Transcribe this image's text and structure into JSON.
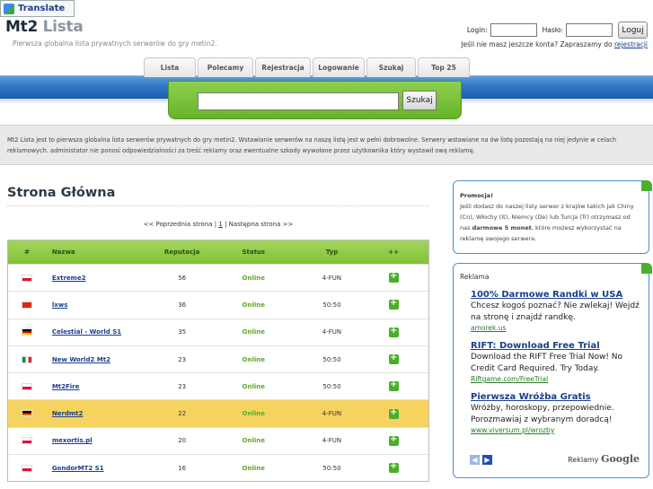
{
  "translate": {
    "label": "Translate"
  },
  "brand": {
    "name_a": "Mt2",
    "name_b": "Lista",
    "tagline": "Pierwsza globalna lista prywatnych serwerów do gry metin2."
  },
  "login": {
    "login_label": "Login:",
    "password_label": "Hasło:",
    "submit_label": "Loguj",
    "register_prompt": "Jeśli nie masz jeszcze konta? Zapraszamy do",
    "register_link": "rejestracji"
  },
  "nav": {
    "tabs": [
      "Lista",
      "Polecamy",
      "Rejestracja",
      "Logowanie",
      "Szukaj",
      "Top 25"
    ]
  },
  "search": {
    "value": "",
    "button_label": "Szukaj"
  },
  "info": {
    "text": "Mt2 Lista jest to pierwsza globalna lista serwerów prywatnych do gry metin2. Wstawianie serwerów na naszą listę jest w pełni dobrowolne. Serwery wstawiane na ów listę pozostają na niej jedynie w celach reklamowych. administator nie ponosi odpowiedzialności za treść reklamy oraz ewentualne szkody wywołane przez użytkownika który wystawił ową reklamę."
  },
  "main": {
    "heading": "Strona Główna",
    "pager": {
      "prev": "<< Poprzednia strona |",
      "current": "1",
      "next": "| Następna strona >>"
    }
  },
  "table": {
    "headers": {
      "flag": "#",
      "name": "Nazwa",
      "rep": "Reputacja",
      "status": "Status",
      "type": "Typ",
      "vote": "++"
    },
    "rows": [
      {
        "flag": "pl",
        "name": "Extreme2",
        "rep": "56",
        "status": "Online",
        "type": "4-FUN"
      },
      {
        "flag": "cn",
        "name": "lxws",
        "rep": "36",
        "status": "Online",
        "type": "50:50"
      },
      {
        "flag": "de",
        "name": "Celestial - World S1",
        "rep": "35",
        "status": "Online",
        "type": "4-FUN"
      },
      {
        "flag": "it",
        "name": "New World2 Mt2",
        "rep": "23",
        "status": "Online",
        "type": "50:50"
      },
      {
        "flag": "pl",
        "name": "Mt2Fire",
        "rep": "23",
        "status": "Online",
        "type": "50:50"
      },
      {
        "flag": "de",
        "name": "Nerdmt2",
        "rep": "22",
        "status": "Online",
        "type": "4-FUN"
      },
      {
        "flag": "pl",
        "name": "mexortis.pl",
        "rep": "20",
        "status": "Online",
        "type": "4-FUN"
      },
      {
        "flag": "pl",
        "name": "GondorMT2 S1",
        "rep": "16",
        "status": "Online",
        "type": "50:50"
      }
    ]
  },
  "promo": {
    "title": "Promocja!",
    "text_a": "Jeśli dodasz do naszej listy serwer z krajów takich jak Chiny (Cn), Włochy (It), Niemcy (De) lub Turcja (Tr) otrzymasz od nas ",
    "bold": "darmowe 5 monet",
    "text_b": ", które możesz wykorzystać na reklamę swojego serwera."
  },
  "ads": {
    "title": "Reklama",
    "items": [
      {
        "title": "100% Darmowe Randki w USA",
        "text": "Chcesz kogoś poznać? Nie zwlekaj! Wejdź na stronę i znajdź randkę.",
        "url": "amorek.us"
      },
      {
        "title": "RIFT: Download Free Trial",
        "text": "Download the RIFT Free Trial Now! No Credit Card Required. Try Today.",
        "url": "Riftgame.com/FreeTrial"
      },
      {
        "title": "Pierwsza Wróżba Gratis",
        "text": "Wróżby, horoskopy, przepowiednie. Porozmawiaj z wybranym doradcą!",
        "url": "www.viversum.pl/wrozby"
      }
    ],
    "footer_label": "Reklamy",
    "footer_brand": "Google"
  },
  "colors": {
    "accent_green": "#84c037",
    "accent_blue": "#2f75c6",
    "highlight_row": "#f6d35f"
  }
}
